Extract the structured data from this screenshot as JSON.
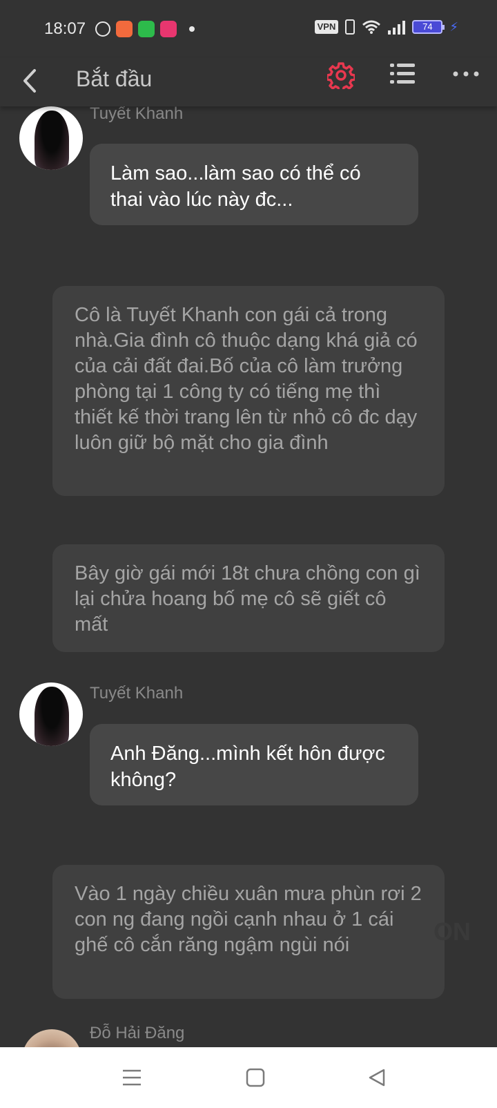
{
  "status_bar": {
    "time": "18:07",
    "vpn_label": "VPN",
    "battery_level": "74",
    "icons": [
      "messenger-icon",
      "game-app-icon",
      "shopping-app-icon",
      "lazada-app-icon",
      "notification-dot",
      "vibrate-icon",
      "wifi-icon",
      "signal-icon",
      "battery-icon",
      "charging-icon"
    ],
    "battery_color": "#4a4ad6"
  },
  "header": {
    "title": "Bắt đầu",
    "back_icon": "chevron-left-icon",
    "settings_icon": "gear-icon",
    "list_icon": "list-icon",
    "more_icon": "more-dots-icon",
    "accent_color": "#e8384f"
  },
  "messages": [
    {
      "type": "character",
      "sender": "Tuyết Khanh",
      "text": "Làm sao...làm sao có thể có thai vào lúc này đc..."
    },
    {
      "type": "narration",
      "text": "Cô là Tuyết Khanh con gái cả trong nhà.Gia đình cô thuộc dạng khá giả có của cải đất đai.Bố của cô làm trưởng phòng tại 1 công ty có tiếng mẹ thì thiết kế thời trang lên từ nhỏ cô đc dạy luôn giữ bộ mặt cho gia đình"
    },
    {
      "type": "narration",
      "text": "Bây giờ gái mới 18t chưa chồng con gì lại chửa hoang bố mẹ cô sẽ giết cô mất"
    },
    {
      "type": "character",
      "sender": "Tuyết Khanh",
      "text": "Anh Đăng...mình kết hôn được không?"
    },
    {
      "type": "narration",
      "text": "Vào 1 ngày chiều xuân mưa phùn rơi 2 con ng đang ngồi cạnh nhau ở 1 cái ghế cô cắn răng ngậm ngùi nói"
    },
    {
      "type": "character",
      "sender": "Đỗ Hải Đăng",
      "text": ""
    }
  ],
  "watermark": "ON",
  "nav_bar": {
    "icons": [
      "menu-icon",
      "home-square-icon",
      "back-triangle-icon"
    ]
  }
}
